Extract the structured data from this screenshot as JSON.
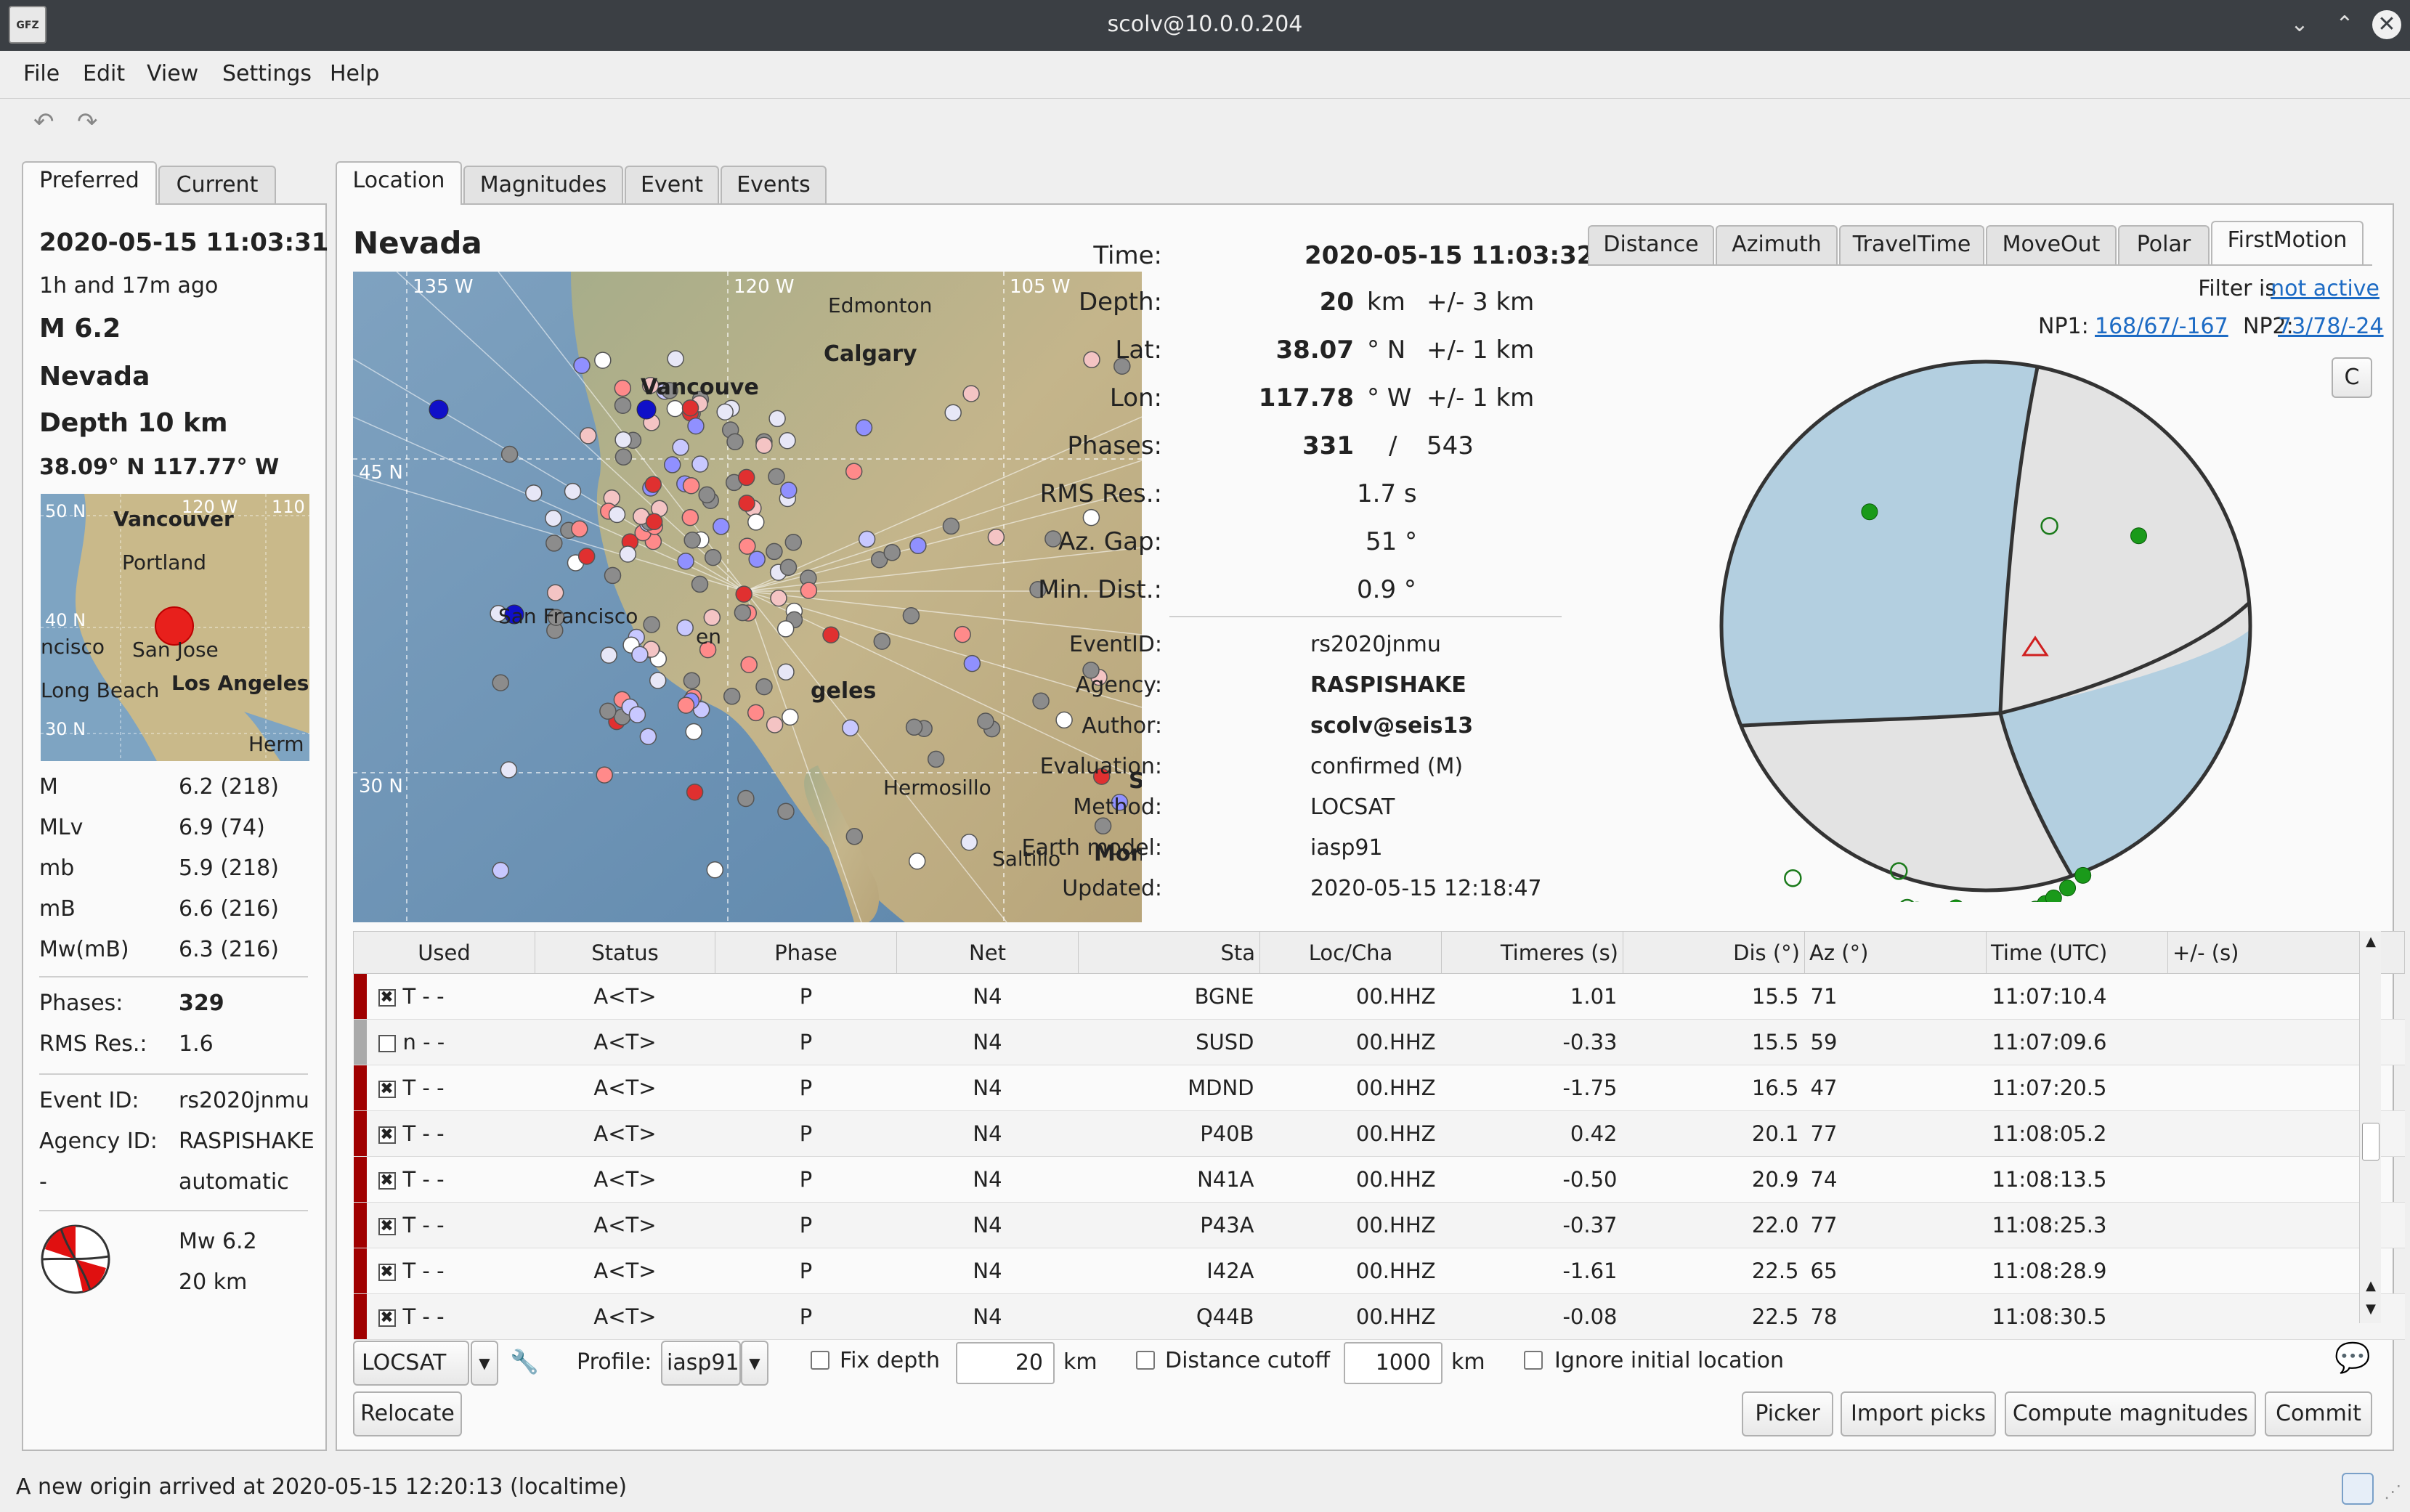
{
  "window": {
    "title": "scolv@10.0.0.204",
    "icon_text": "GFZ"
  },
  "menu": [
    "File",
    "Edit",
    "View",
    "Settings",
    "Help"
  ],
  "left_tabs": [
    "Preferred",
    "Current"
  ],
  "summary": {
    "time": "2020-05-15 11:03:31",
    "ago": "1h and 17m ago",
    "magnitude": "M  6.2",
    "region": "Nevada",
    "depth": "Depth  10 km",
    "coords": "38.09° N  117.77° W",
    "map_labels": [
      "Vancouver",
      "Portland",
      "San Jose",
      "Long Beach",
      "Los Angeles",
      "ncisco",
      "Herm",
      "50 N",
      "40 N",
      "30 N",
      "120 W",
      "110"
    ],
    "magnitudes": [
      {
        "type": "M",
        "value": "6.2 (218)"
      },
      {
        "type": "MLv",
        "value": "6.9 (74)"
      },
      {
        "type": "mb",
        "value": "5.9 (218)"
      },
      {
        "type": "mB",
        "value": "6.6 (216)"
      },
      {
        "type": "Mw(mB)",
        "value": "6.3 (216)"
      }
    ],
    "phases_label": "Phases:",
    "phases_value": "329",
    "rms_label": "RMS Res.:",
    "rms_value": "1.6",
    "event_id_label": "Event ID:",
    "event_id": "rs2020jnmu",
    "agency_id_label": "Agency ID:",
    "agency_id": "RASPISHAKE",
    "mode_label": "-",
    "mode_value": "automatic",
    "fm_mag": "Mw 6.2",
    "fm_depth": "20 km"
  },
  "main_tabs": [
    "Location",
    "Magnitudes",
    "Event",
    "Events"
  ],
  "region_title": "Nevada",
  "map_labels": [
    "Edmonton",
    "Calgary",
    "Vancouve",
    "San Francisco",
    "geles",
    "Hermosillo",
    "Saltillo",
    "Mon",
    "S",
    "135 W",
    "120 W",
    "105 W",
    "45 N",
    "30 N",
    "en"
  ],
  "origin": {
    "time_label": "Time:",
    "time": "2020-05-15 11:03:32",
    "depth_label": "Depth:",
    "depth": "20",
    "depth_unit": "km",
    "depth_err": "+/- 3  km",
    "lat_label": "Lat:",
    "lat": "38.07",
    "lat_unit": "° N",
    "lat_err": "+/- 1  km",
    "lon_label": "Lon:",
    "lon": "117.78",
    "lon_unit": "° W",
    "lon_err": "+/- 1  km",
    "phases_label": "Phases:",
    "phases_used": "331",
    "phases_sep": "/",
    "phases_total": "543",
    "rms_label": "RMS Res.:",
    "rms": "1.7  s",
    "gap_label": "Az. Gap:",
    "gap": "51  °",
    "dist_label": "Min. Dist.:",
    "dist": "0.9  °",
    "event_id_label": "EventID:",
    "event_id": "rs2020jnmu",
    "agency_label": "Agency:",
    "agency": "RASPISHAKE",
    "author_label": "Author:",
    "author": "scolv@seis13",
    "eval_label": "Evaluation:",
    "eval": "confirmed (M)",
    "method_label": "Method:",
    "method": "LOCSAT",
    "earth_label": "Earth model:",
    "earth": "iasp91",
    "updated_label": "Updated:",
    "updated": "2020-05-15 12:18:47"
  },
  "plot_tabs": [
    "Distance",
    "Azimuth",
    "TravelTime",
    "MoveOut",
    "Polar",
    "FirstMotion"
  ],
  "filter": {
    "label": "Filter is",
    "value": "not active"
  },
  "np": {
    "np1_label": "NP1:",
    "np1": "168/67/-167",
    "np2_label": "NP2:",
    "np2": "73/78/-24"
  },
  "plot_button": "C",
  "table": {
    "columns": [
      "Used",
      "Status",
      "Phase",
      "Net",
      "Sta",
      "Loc/Cha",
      "Timeres (s)",
      "Dis (°)",
      "Az (°)",
      "Time (UTC)",
      "+/- (s)"
    ],
    "rows": [
      {
        "checked": true,
        "flag": "T  -  -",
        "status": "A<T>",
        "phase": "P",
        "net": "N4",
        "sta": "BGNE",
        "loc": "00.HHZ",
        "res": "1.01",
        "dis": "15.5",
        "az": "71",
        "time": "11:07:10.4"
      },
      {
        "checked": false,
        "flag": "n  -  -",
        "status": "A<T>",
        "phase": "P",
        "net": "N4",
        "sta": "SUSD",
        "loc": "00.HHZ",
        "res": "-0.33",
        "dis": "15.5",
        "az": "59",
        "time": "11:07:09.6"
      },
      {
        "checked": true,
        "flag": "T  -  -",
        "status": "A<T>",
        "phase": "P",
        "net": "N4",
        "sta": "MDND",
        "loc": "00.HHZ",
        "res": "-1.75",
        "dis": "16.5",
        "az": "47",
        "time": "11:07:20.5"
      },
      {
        "checked": true,
        "flag": "T  -  -",
        "status": "A<T>",
        "phase": "P",
        "net": "N4",
        "sta": "P40B",
        "loc": "00.HHZ",
        "res": "0.42",
        "dis": "20.1",
        "az": "77",
        "time": "11:08:05.2"
      },
      {
        "checked": true,
        "flag": "T  -  -",
        "status": "A<T>",
        "phase": "P",
        "net": "N4",
        "sta": "N41A",
        "loc": "00.HHZ",
        "res": "-0.50",
        "dis": "20.9",
        "az": "74",
        "time": "11:08:13.5"
      },
      {
        "checked": true,
        "flag": "T  -  -",
        "status": "A<T>",
        "phase": "P",
        "net": "N4",
        "sta": "P43A",
        "loc": "00.HHZ",
        "res": "-0.37",
        "dis": "22.0",
        "az": "77",
        "time": "11:08:25.3"
      },
      {
        "checked": true,
        "flag": "T  -  -",
        "status": "A<T>",
        "phase": "P",
        "net": "N4",
        "sta": "I42A",
        "loc": "00.HHZ",
        "res": "-1.61",
        "dis": "22.5",
        "az": "65",
        "time": "11:08:28.9"
      },
      {
        "checked": true,
        "flag": "T  -  -",
        "status": "A<T>",
        "phase": "P",
        "net": "N4",
        "sta": "Q44B",
        "loc": "00.HHZ",
        "res": "-0.08",
        "dis": "22.5",
        "az": "78",
        "time": "11:08:30.5"
      }
    ]
  },
  "controls": {
    "locator": "LOCSAT",
    "profile_label": "Profile:",
    "profile": "iasp91",
    "fix_depth_label": "Fix depth",
    "fix_depth_value": "20",
    "fix_depth_unit": "km",
    "dist_cutoff_label": "Distance cutoff",
    "dist_cutoff_value": "1000",
    "dist_cutoff_unit": "km",
    "ignore_label": "Ignore initial location",
    "relocate": "Relocate",
    "picker": "Picker",
    "import_picks": "Import picks",
    "compute_mags": "Compute magnitudes",
    "commit": "Commit"
  },
  "status_message": "A new origin arrived at 2020-05-15 12:20:13 (localtime)",
  "colors": {
    "accent_red": "#a00000",
    "link": "#1d6bc4",
    "fm_blue": "#b3cfe0",
    "fm_gray": "#e2e2e2",
    "polarity_green": "#1a9a1a"
  }
}
